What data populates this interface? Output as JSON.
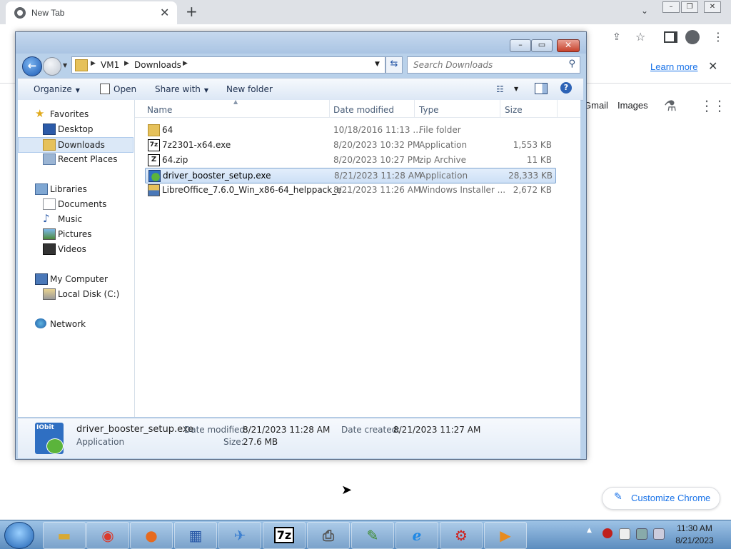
{
  "chrome": {
    "tab_title": "New Tab",
    "infobar_learn_more": "Learn more",
    "ntp_links": [
      "Gmail",
      "Images"
    ],
    "customize_label": "Customize Chrome",
    "accent": "#1a73e8"
  },
  "explorer": {
    "breadcrumb": [
      "VM1",
      "Downloads"
    ],
    "search_placeholder": "Search Downloads",
    "toolbar": {
      "organize": "Organize",
      "open": "Open",
      "share_with": "Share with",
      "new_folder": "New folder"
    },
    "nav": {
      "favorites": "Favorites",
      "desktop": "Desktop",
      "downloads": "Downloads",
      "recent_places": "Recent Places",
      "libraries": "Libraries",
      "documents": "Documents",
      "music": "Music",
      "pictures": "Pictures",
      "videos": "Videos",
      "my_computer": "My Computer",
      "local_disk": "Local Disk (C:)",
      "network": "Network"
    },
    "columns": {
      "name": "Name",
      "date_modified": "Date modified",
      "type": "Type",
      "size": "Size"
    },
    "files": [
      {
        "name": "64",
        "date": "10/18/2016 11:13 ...",
        "type": "File folder",
        "size": "",
        "icon": "folder-icon"
      },
      {
        "name": "7z2301-x64.exe",
        "date": "8/20/2023 10:32 PM",
        "type": "Application",
        "size": "1,553 KB",
        "icon": "7zip-app-icon"
      },
      {
        "name": "64.zip",
        "date": "8/20/2023 10:27 PM",
        "type": "zip Archive",
        "size": "11 KB",
        "icon": "zip-file-icon"
      },
      {
        "name": "driver_booster_setup.exe",
        "date": "8/21/2023 11:28 AM",
        "type": "Application",
        "size": "28,333 KB",
        "icon": "installer-icon",
        "selected": true
      },
      {
        "name": "LibreOffice_7.6.0_Win_x86-64_helppack_e...",
        "date": "8/21/2023 11:26 AM",
        "type": "Windows Installer ...",
        "size": "2,672 KB",
        "icon": "msi-installer-icon"
      }
    ],
    "details": {
      "filename": "driver_booster_setup.exe",
      "filetype": "Application",
      "date_modified_label": "Date modified:",
      "date_modified": "8/21/2023 11:28 AM",
      "date_created_label": "Date created:",
      "date_created": "8/21/2023 11:27 AM",
      "size_label": "Size:",
      "size": "27.6 MB",
      "icon_text": "IObit"
    }
  },
  "taskbar": {
    "time": "11:30 AM",
    "date": "8/21/2023",
    "sevenzip_label": "7z"
  }
}
